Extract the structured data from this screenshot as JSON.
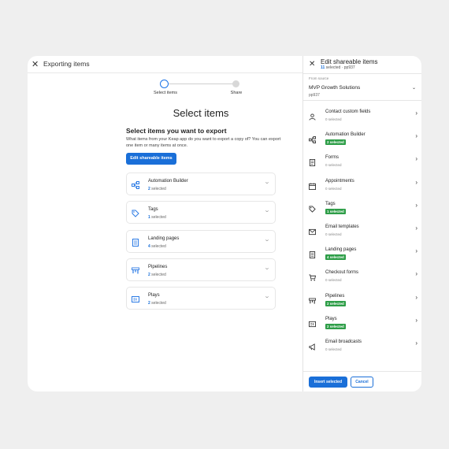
{
  "header": {
    "title": "Exporting items"
  },
  "stepper": {
    "step1": "Select items",
    "step2": "Share"
  },
  "main": {
    "heading": "Select items",
    "subheading": "Select items you want to export",
    "description": "What items from your Keap app do you want to export a copy of? You can export one item or many items at once.",
    "edit_button": "Edit shareable items",
    "cards": [
      {
        "name": "Automation Builder",
        "count": "2",
        "suffix": " selected",
        "icon": "automation-icon"
      },
      {
        "name": "Tags",
        "count": "1",
        "suffix": " selected",
        "icon": "tag-icon"
      },
      {
        "name": "Landing pages",
        "count": "4",
        "suffix": " selected",
        "icon": "landing-page-icon"
      },
      {
        "name": "Pipelines",
        "count": "2",
        "suffix": " selected",
        "icon": "pipeline-icon"
      },
      {
        "name": "Plays",
        "count": "2",
        "suffix": " selected",
        "icon": "plays-icon"
      }
    ]
  },
  "panel": {
    "title": "Edit shareable items",
    "selected_count": "11",
    "selected_suffix": " selected · pp937",
    "from_label": "From source",
    "source_name": "MVP Growth Solutions",
    "source_id": "pp937",
    "items": [
      {
        "name": "Contact custom fields",
        "status": "0 selected",
        "selected": false,
        "icon": "person-icon"
      },
      {
        "name": "Automation Builder",
        "status": "2 selected",
        "selected": true,
        "icon": "automation-icon"
      },
      {
        "name": "Forms",
        "status": "0 selected",
        "selected": false,
        "icon": "form-icon"
      },
      {
        "name": "Appointments",
        "status": "0 selected",
        "selected": false,
        "icon": "calendar-icon"
      },
      {
        "name": "Tags",
        "status": "1 selected",
        "selected": true,
        "icon": "tag-icon"
      },
      {
        "name": "Email templates",
        "status": "0 selected",
        "selected": false,
        "icon": "mail-icon"
      },
      {
        "name": "Landing pages",
        "status": "4 selected",
        "selected": true,
        "icon": "landing-page-icon"
      },
      {
        "name": "Checkout forms",
        "status": "0 selected",
        "selected": false,
        "icon": "cart-icon"
      },
      {
        "name": "Pipelines",
        "status": "2 selected",
        "selected": true,
        "icon": "pipeline-icon"
      },
      {
        "name": "Plays",
        "status": "2 selected",
        "selected": true,
        "icon": "plays-icon"
      },
      {
        "name": "Email broadcasts",
        "status": "0 selected",
        "selected": false,
        "icon": "megaphone-icon"
      }
    ],
    "insert_button": "Insert selected",
    "cancel_button": "Cancel"
  },
  "colors": {
    "accent": "#1a6fd8",
    "badge": "#2e9e48",
    "background": "#efefef"
  }
}
